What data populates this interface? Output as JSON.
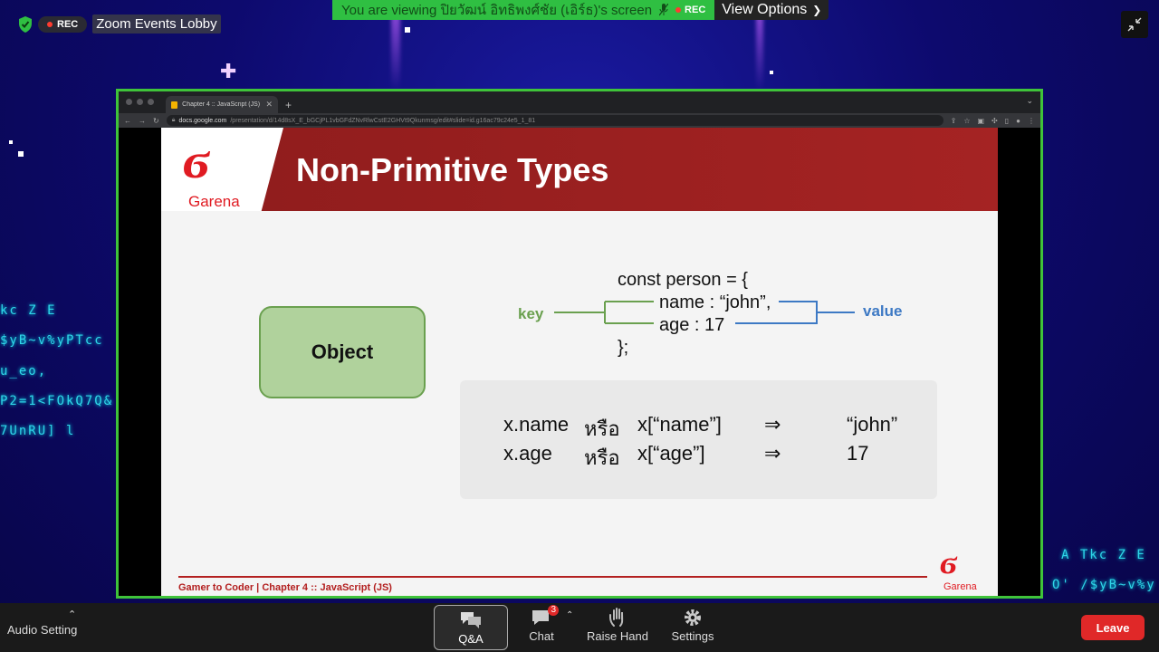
{
  "window": {
    "lobby_label": "Zoom Events Lobby",
    "rec_label": "REC"
  },
  "banner": {
    "viewing_text": "You are viewing ปิยวัฒน์ อิทธิพงศ์ชัย (เอิร์ธ)'s screen",
    "rec_label": "REC",
    "view_options_label": "View Options"
  },
  "background": {
    "matrix_left": [
      "kc Z E",
      "$yB~v%yPTcc",
      "u_eo,",
      "P2=1<FOkQ7Q&",
      "7UnRU] l"
    ],
    "matrix_right": [
      "A Tkc Z E",
      "O' /$yB~v%y"
    ]
  },
  "browser": {
    "tab_title": "Chapter 4 :: JavaScript (JS) - G",
    "url_domain": "docs.google.com",
    "url_path": "/presentation/d/14d8sX_E_bGCjPL1vbGFdZNvRlwCstE2GHVt9Qkunmsg/edit#slide=id.g16ac79c24e5_1_81"
  },
  "slide": {
    "title": "Non-Primitive Types",
    "logo_text": "Garena",
    "object_label": "Object",
    "code_lines": [
      "const person = {",
      "name : “john”,",
      "age : 17",
      "};"
    ],
    "key_label": "key",
    "value_label": "value",
    "examples": [
      {
        "expr": "x.name",
        "or": "หรือ",
        "alt": "x[“name”]",
        "arrow": "⇒",
        "result": "“john”"
      },
      {
        "expr": "x.age",
        "or": "หรือ",
        "alt": "x[“age”]",
        "arrow": "⇒",
        "result": "17"
      }
    ],
    "footer_text": "Gamer to Coder | Chapter 4 :: JavaScript (JS)",
    "small_logo_text": "Garena"
  },
  "toolbar": {
    "audio_label": "Audio Setting",
    "qa_label": "Q&A",
    "chat_label": "Chat",
    "chat_badge": "3",
    "raise_hand_label": "Raise Hand",
    "settings_label": "Settings",
    "leave_label": "Leave"
  },
  "colors": {
    "share_border": "#3fc33a",
    "banner_green": "#2fbf42",
    "leave_red": "#e02828",
    "slide_header_red": "#a52323",
    "key_green": "#6aa04f",
    "value_blue": "#3d79c4"
  }
}
